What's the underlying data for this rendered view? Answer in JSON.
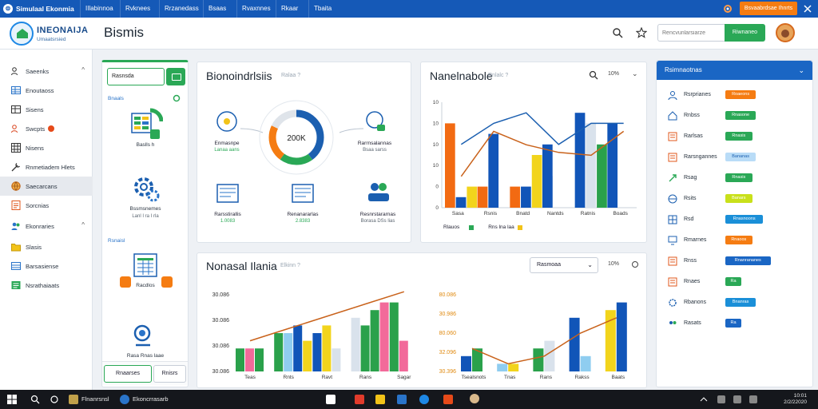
{
  "topbar": {
    "brand": "Simulaal Ekonmia",
    "tabs": [
      "IIlabinnoa",
      "Rvknees",
      "Rrzanedass",
      "Bsaas",
      "Rvaxnnes",
      "Rkaar",
      "Tbaita"
    ],
    "orange_button": "Bsvaabrdsae Ihnrts"
  },
  "header": {
    "logo_title": "INEONAIJA",
    "logo_sub": "Umaatsrsied",
    "page_title": "Bismis",
    "search_placeholder": "Rencvunlarsiarze",
    "green_button": "Riwnaneo"
  },
  "sidebar": {
    "items": [
      {
        "label": "Saeenks",
        "icon": "people-icon",
        "chevron": "^"
      },
      {
        "label": "Enoutaoss",
        "icon": "table-icon"
      },
      {
        "label": "Sisens",
        "icon": "table-icon"
      },
      {
        "label": "Swcpts",
        "icon": "people-icon"
      },
      {
        "label": "Nisens",
        "icon": "grid-icon"
      },
      {
        "label": "Rnmetiadem Hlets",
        "icon": "tools-icon"
      },
      {
        "label": "Saecarcans",
        "icon": "globe-icon"
      },
      {
        "label": "Sorcnias",
        "icon": "sheet-icon"
      },
      {
        "label": "Ekonraries",
        "icon": "people-icon",
        "chevron": "^"
      },
      {
        "label": "Slasis",
        "icon": "folder-icon"
      },
      {
        "label": "Barsasiense",
        "icon": "table-icon"
      },
      {
        "label": "Nsrathaiaats",
        "icon": "sheet-icon"
      }
    ]
  },
  "cards_panel": {
    "input_value": "Rasnsda",
    "section1_label": "Bnaals",
    "section2_label": "Rsnaisl",
    "cards": [
      {
        "caption": "Baslls h",
        "value": ""
      },
      {
        "caption": "Bssmsnemes",
        "value": "Lanl I ra I rla"
      },
      {
        "caption": "Racdlos",
        "value": ""
      },
      {
        "caption": "Rasa Rnas laae",
        "value": ""
      }
    ],
    "footer_buttons": [
      "Rnaarses",
      "Rnisrs"
    ]
  },
  "bio_panel": {
    "title": "Bionoindrlsiis",
    "subtitle": "Ralaa ?",
    "donut_center": "200K",
    "items": [
      {
        "label": "Enmasnpe",
        "value": "Lanaa aans"
      },
      {
        "label": "Rarrnsalannas",
        "value": "Bsaa sarss"
      },
      {
        "label": "Rarsstirallis",
        "value": "1.0083"
      },
      {
        "label": "Renanararlas",
        "value": "2.8383"
      },
      {
        "label": "Resnrstararnas",
        "value": "Borasa DSs lias"
      }
    ],
    "donut": {
      "blue": 40,
      "green": 20,
      "orange": 22,
      "gray": 18
    }
  },
  "net_panel": {
    "title": "Nanelnabole",
    "subtitle": "Rnlalc ?",
    "zoom": "10%",
    "legend": [
      "Rlauos",
      "Rns lna laa"
    ],
    "chart_data": {
      "type": "bar",
      "categories": [
        "Sasa",
        "Rsnis",
        "Bnatd",
        "Nantds",
        "Ratnis",
        "Boads"
      ],
      "yticks": [
        "10",
        "10",
        "10",
        "10",
        "0",
        "0"
      ],
      "series": [
        {
          "values": [
            8,
            2,
            2,
            0,
            0,
            0
          ],
          "color": "#f26a12"
        },
        {
          "values": [
            1,
            7,
            2,
            6,
            9,
            8
          ],
          "color": "#1155b8"
        },
        {
          "values": [
            2,
            0,
            5,
            0,
            0,
            0
          ],
          "color": "#f2d41c"
        },
        {
          "values": [
            0,
            0,
            3,
            0,
            8,
            0
          ],
          "color": "#d9e2ec"
        },
        {
          "values": [
            0,
            0,
            0,
            0,
            6,
            0
          ],
          "color": "#2aa14b"
        }
      ],
      "line": [
        6,
        8,
        9,
        6,
        8,
        8
      ]
    }
  },
  "bottom_panel": {
    "title": "Nonasal Ilania",
    "subtitle": "Elkinn ?",
    "select_value": "Rasmoaa",
    "zoom": "10%",
    "chart_data": {
      "type": "bar",
      "left_yticks": [
        "30.086",
        "30.086",
        "30.086",
        "30.086"
      ],
      "right_yticks": [
        "80.086",
        "30.986",
        "80.060",
        "32.096",
        "30.396"
      ],
      "left_categories": [
        "Teas",
        "Rnts",
        "Ravt",
        "Rans",
        "Sagar"
      ],
      "right_categories": [
        "Tsealsnots",
        "Tnas",
        "Rans",
        "Rakss",
        "Baats"
      ]
    }
  },
  "right_panel": {
    "title": "Rsimnaotnas",
    "rows": [
      {
        "label": "Rsrprianes",
        "icon": "person-icon",
        "pill": "Roaeons",
        "pill_color": "#f57c12"
      },
      {
        "label": "Rnbss",
        "icon": "home-icon",
        "pill": "Rnasone",
        "pill_color": "#2aa856"
      },
      {
        "label": "Rarlsas",
        "icon": "sheet-icon",
        "pill": "Rnasis",
        "pill_color": "#2aa856"
      },
      {
        "label": "Rarsngannes",
        "icon": "sheet-icon",
        "pill": "Bananas",
        "pill_color": "#b9dcf7"
      },
      {
        "label": "Rsag",
        "icon": "link-icon",
        "pill": "Rnasis",
        "pill_color": "#2aa856"
      },
      {
        "label": "Rsits",
        "icon": "globe-icon",
        "pill": "Banars",
        "pill_color": "#c9e01a"
      },
      {
        "label": "Rsd",
        "icon": "grid-icon",
        "pill": "Rnasnoons",
        "pill_color": "#1a8fd8"
      },
      {
        "label": "Rmarnes",
        "icon": "monitor-icon",
        "pill": "Rnaoos",
        "pill_color": "#f57c12"
      },
      {
        "label": "Rnss",
        "icon": "sheet-icon",
        "pill": "Rnanrananes",
        "pill_color": "#1a66c4"
      },
      {
        "label": "Rnaes",
        "icon": "sheet-icon",
        "pill": "Ra",
        "pill_color": "#2aa856"
      },
      {
        "label": "Rbanons",
        "icon": "gear-icon",
        "pill": "Bnanras",
        "pill_color": "#1a8fd8"
      },
      {
        "label": "Rasats",
        "icon": "people-icon",
        "pill": "Ra",
        "pill_color": "#1a66c4"
      }
    ]
  },
  "taskbar": {
    "apps": [
      "Flnanrsnsl",
      "Ekoncrrasarb"
    ],
    "clock_time": "10:01",
    "clock_date": "2/2/22020"
  }
}
